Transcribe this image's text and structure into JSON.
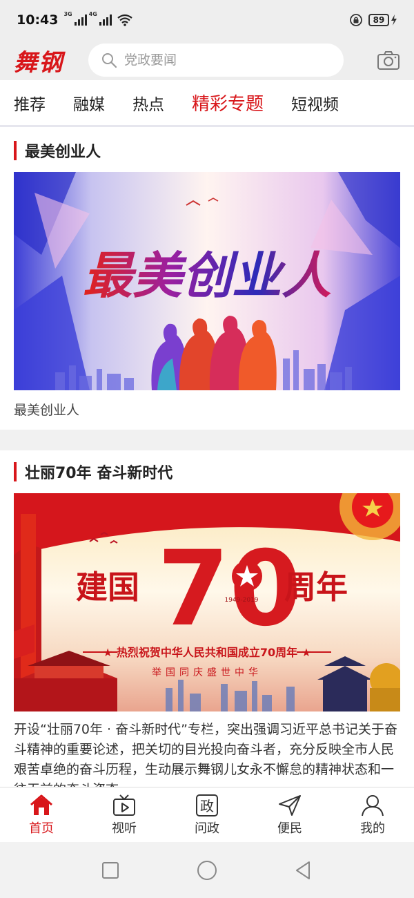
{
  "status": {
    "time": "10:43",
    "sim1": "3G",
    "sim2": "4G",
    "battery": "89"
  },
  "header": {
    "logo": "舞钢",
    "search_placeholder": "党政要闻"
  },
  "tabs": [
    {
      "label": "推荐",
      "active": false
    },
    {
      "label": "融媒",
      "active": false
    },
    {
      "label": "热点",
      "active": false
    },
    {
      "label": "精彩专题",
      "active": true
    },
    {
      "label": "短视频",
      "active": false
    }
  ],
  "sections": [
    {
      "title": "最美创业人",
      "banner_text": "最美创业人",
      "caption": "最美创业人"
    },
    {
      "title": "壮丽70年 奋斗新时代",
      "banner_left": "建国",
      "banner_number": "70",
      "banner_right": "周年",
      "banner_years": "1949-2019",
      "banner_slogan": "★ 热烈祝贺中华人民共和国成立70周年 ★",
      "banner_sub": "举国同庆盛世中华",
      "description": "开设“壮丽70年 · 奋斗新时代”专栏，突出强调习近平总书记关于奋斗精神的重要论述，把关切的目光投向奋斗者，充分反映全市人民艰苦卓绝的奋斗历程，生动展示舞钢儿女永不懈怠的精神状态和一往无前的奋斗姿态"
    }
  ],
  "bottom_nav": [
    {
      "label": "首页",
      "icon": "home-icon",
      "active": true
    },
    {
      "label": "视听",
      "icon": "tv-icon",
      "active": false
    },
    {
      "label": "问政",
      "icon": "zheng-icon",
      "icon_char": "政",
      "active": false
    },
    {
      "label": "便民",
      "icon": "send-icon",
      "active": false
    },
    {
      "label": "我的",
      "icon": "user-icon",
      "active": false
    }
  ],
  "colors": {
    "accent": "#d8161a",
    "background": "#eeeeee"
  }
}
